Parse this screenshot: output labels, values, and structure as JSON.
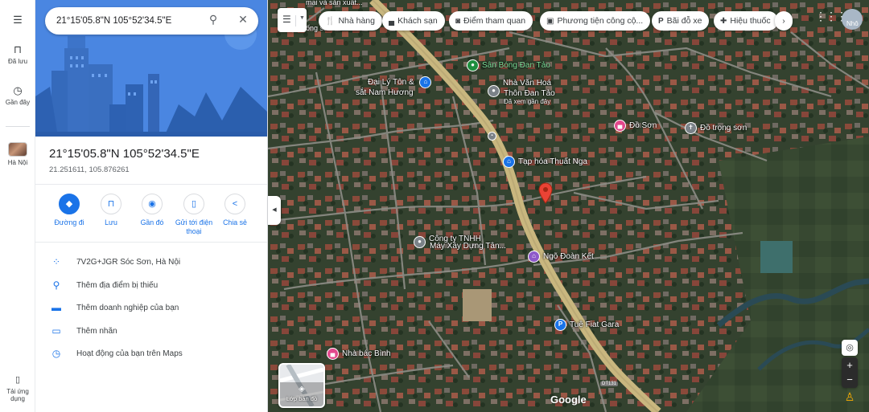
{
  "rail": {
    "menu_icon": "menu-icon",
    "saved_label": "Đã lưu",
    "recent_label": "Gần đây",
    "place_label": "Hà Nội",
    "app_label": "Tải ứng dụng"
  },
  "search": {
    "value": "21°15'05.8\"N 105°52'34.5\"E"
  },
  "place": {
    "title": "21°15'05.8\"N 105°52'34.5\"E",
    "decimal": "21.251611, 105.876261"
  },
  "actions": [
    {
      "label": "Đường đi",
      "icon": "directions-icon"
    },
    {
      "label": "Lưu",
      "icon": "bookmark-icon"
    },
    {
      "label": "Gần đó",
      "icon": "nearby-icon"
    },
    {
      "label": "Gửi tới điện thoại",
      "icon": "send-to-phone-icon"
    },
    {
      "label": "Chia sẻ",
      "icon": "share-icon"
    }
  ],
  "details": [
    {
      "text": "7V2G+JGR Sóc Sơn, Hà Nội",
      "icon": "plus-code-icon"
    },
    {
      "text": "Thêm địa điểm bị thiếu",
      "icon": "add-place-icon"
    },
    {
      "text": "Thêm doanh nghiệp của bạn",
      "icon": "add-business-icon"
    },
    {
      "text": "Thêm nhãn",
      "icon": "label-icon"
    },
    {
      "text": "Hoạt động của bạn trên Maps",
      "icon": "history-icon"
    }
  ],
  "chips": [
    {
      "label": "Nhà hàng",
      "icon": "restaurant-icon"
    },
    {
      "label": "Khách sạn",
      "icon": "hotel-icon"
    },
    {
      "label": "Điểm tham quan",
      "icon": "camera-icon"
    },
    {
      "label": "Phương tiện công cộ...",
      "icon": "transit-icon"
    },
    {
      "label": "Bãi đỗ xe",
      "icon": "parking-icon"
    },
    {
      "label": "Hiệu thuốc",
      "icon": "pharmacy-icon"
    }
  ],
  "pois": {
    "san_bong": "Sân Bóng Đan Tảo",
    "dai_ly_1": "Đại Lý Tôn &",
    "dai_ly_2": "sắt Nam Hương",
    "nha_van_hoa_1": "Nhà Văn Hoá",
    "nha_van_hoa_2": "Thôn Đan Tảo",
    "nha_van_hoa_sub": "Đã xem gần đây",
    "do_son": "Đồ Sơn",
    "do_trong_son": "Đồ trọng sơn",
    "tap_hoa": "Tạp hóa Thuất Nga",
    "cong_ty_1": "Công ty TNHH",
    "cong_ty_2": "Máy Xây Dựng Tân...",
    "ngo_doan_ket": "Ngõ Đoàn Kết",
    "tue_fiat": "Tuệ Fiat Gara",
    "nha_bac_binh": "Nhà bác Bình",
    "top_1": "mại và sản xuất...",
    "top_2": "ống sản Tân Minh",
    "road_code": "DT131",
    "nho_label": "Nhô"
  },
  "layers": {
    "label": "Lớp bản đồ"
  },
  "brand": "Google"
}
